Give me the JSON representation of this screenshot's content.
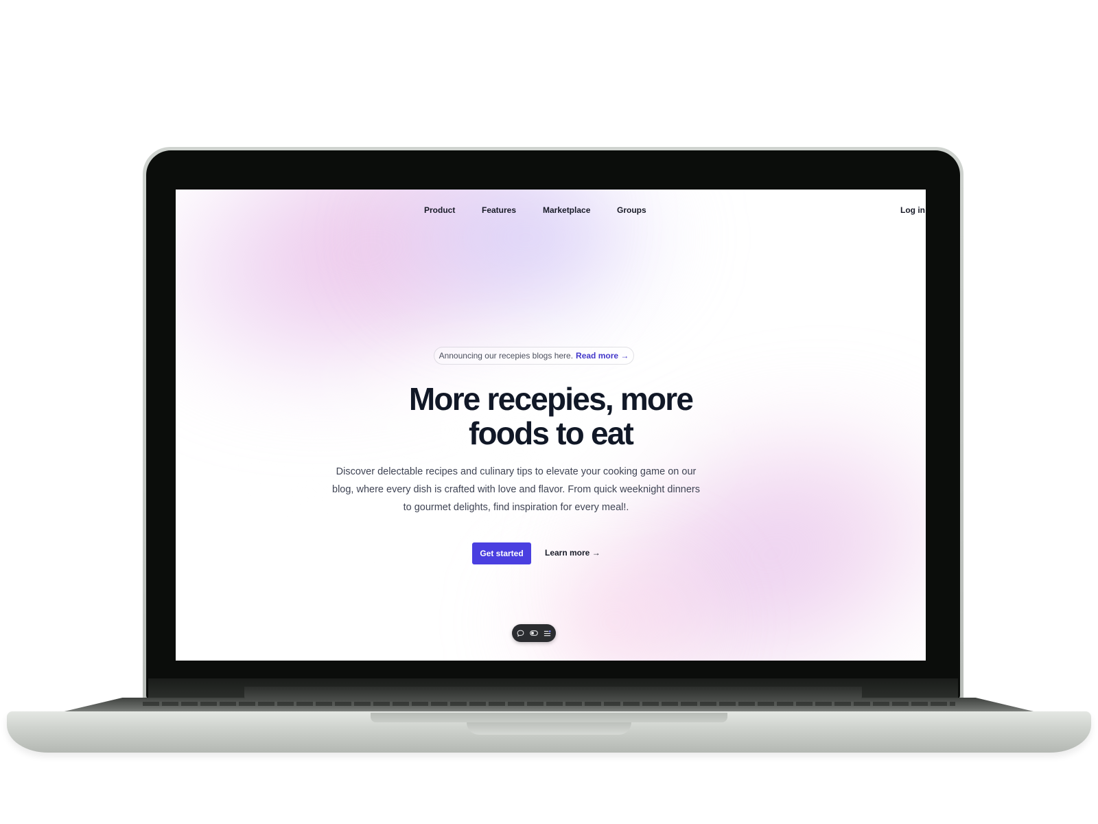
{
  "nav": {
    "items": [
      {
        "label": "Product"
      },
      {
        "label": "Features"
      },
      {
        "label": "Marketplace"
      },
      {
        "label": "Groups"
      }
    ],
    "login_label": "Log in"
  },
  "hero": {
    "announcement": {
      "text": "Announcing our recepies blogs here.",
      "link_label": "Read more →"
    },
    "headline_lines": [
      "More recepies, more",
      "foods to eat"
    ],
    "description_lines": [
      "Discover delectable recipes and culinary tips to elevate your cooking game on our",
      "blog, where every dish is crafted with love and flavor. From quick weeknight dinners",
      "to gourmet delights, find inspiration for every meal!."
    ],
    "primary_cta": "Get started",
    "secondary_cta": "Learn more →"
  },
  "toolbar": {
    "icons": [
      "comment-icon",
      "toggle-icon",
      "settings-list-icon"
    ]
  },
  "colors": {
    "accent": "#4a3fe0",
    "link": "#4338ca",
    "heading": "#111827",
    "body_text": "#3f4454",
    "laptop_bezel": "#0b0d0b",
    "laptop_aluminum": "#cfd3ce"
  }
}
